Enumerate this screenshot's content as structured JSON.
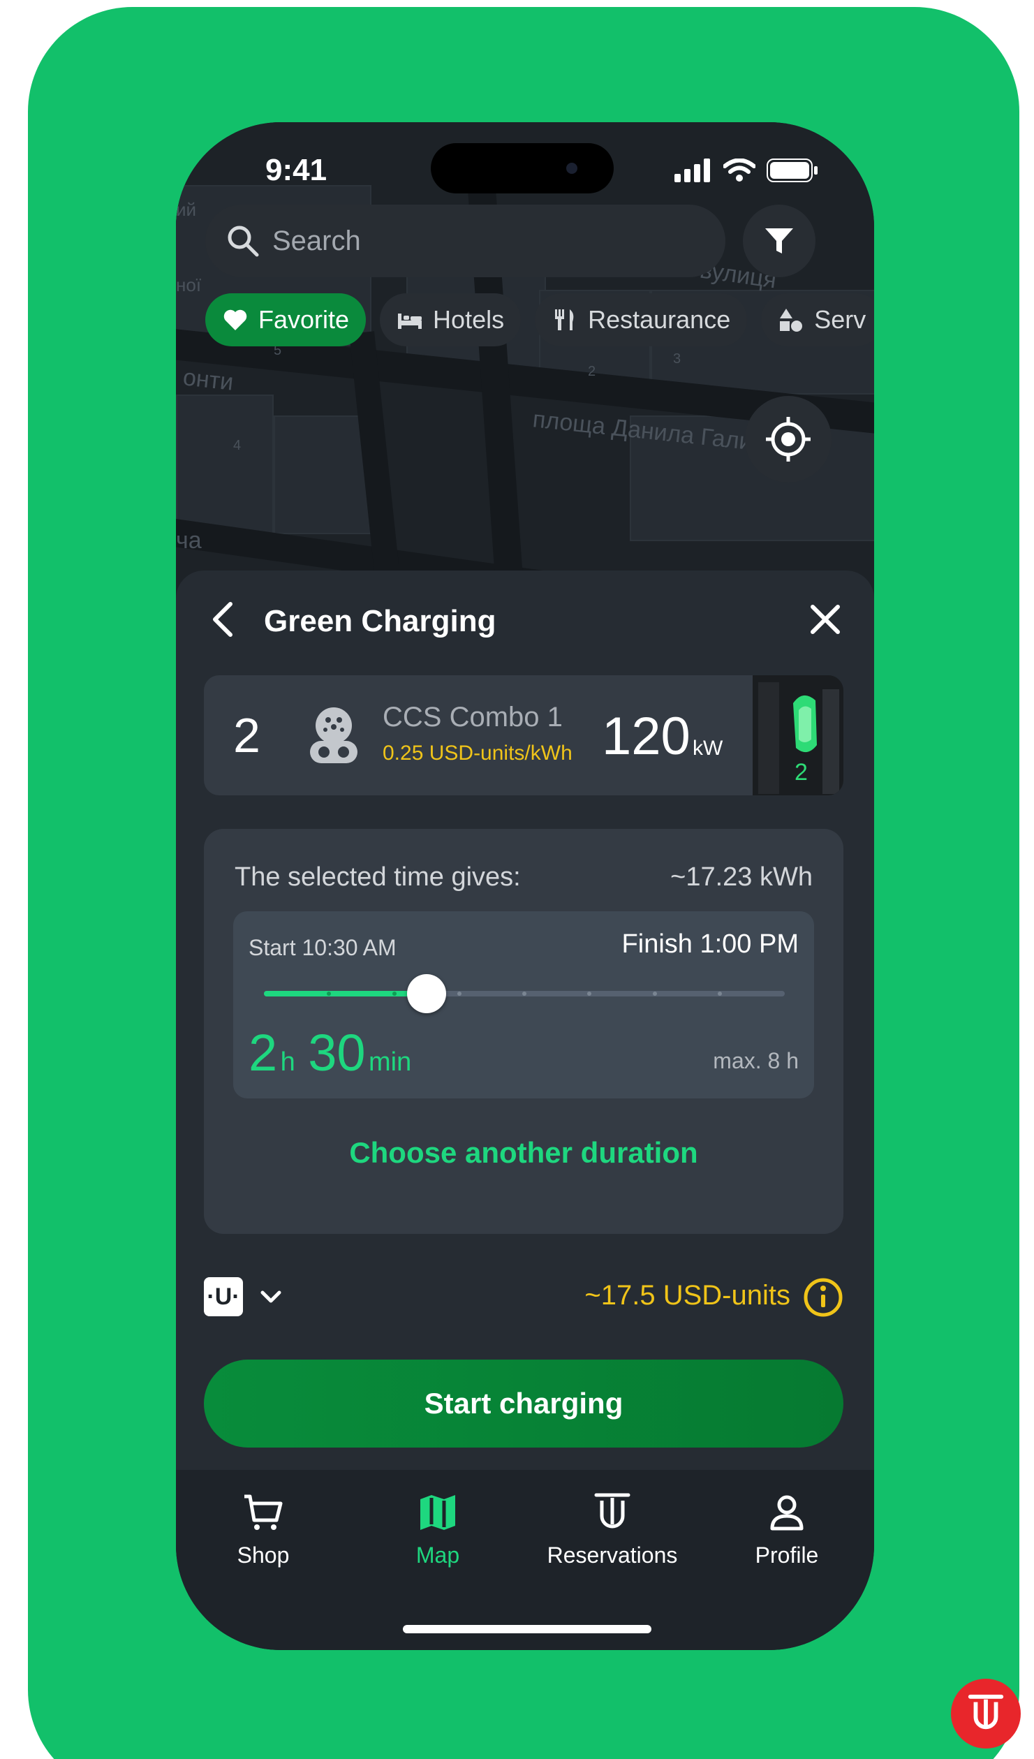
{
  "status_bar": {
    "time": "9:41"
  },
  "search": {
    "placeholder": "Search"
  },
  "chips": [
    {
      "label": "Favorite",
      "icon": "heart-icon"
    },
    {
      "label": "Hotels",
      "icon": "bed-icon"
    },
    {
      "label": "Restaurance",
      "icon": "fork-knife-icon"
    },
    {
      "label": "Serv",
      "icon": "shapes-icon"
    }
  ],
  "map": {
    "street_labels": [
      "вулиця",
      "площа Данила Галицького",
      "онти",
      "нoї",
      "ча",
      "ий"
    ],
    "house_numbers": [
      "5",
      "2",
      "3",
      "4"
    ]
  },
  "station": {
    "title": "Green Charging"
  },
  "connector": {
    "number": "2",
    "type": "CCS Combo 1",
    "price": "0.25 USD-units/kWh",
    "power": "120",
    "power_unit": "kW",
    "photo_badge": "2"
  },
  "time_selection": {
    "label": "The selected time gives:",
    "energy": "~17.23 kWh",
    "start": "Start 10:30 AM",
    "finish": "Finish 1:00 PM",
    "hours": "2",
    "hours_unit": "h",
    "minutes": "30",
    "minutes_unit": "min",
    "max": "max. 8 h",
    "slider_value_hours": 2.5,
    "slider_max_hours": 8,
    "another_duration": "Choose another duration"
  },
  "payment": {
    "currency_symbol": "·U·",
    "total": "~17.5 USD-units"
  },
  "start_button": "Start charging",
  "tabs": [
    {
      "label": "Shop",
      "icon": "cart-icon",
      "active": false
    },
    {
      "label": "Map",
      "icon": "map-icon",
      "active": true
    },
    {
      "label": "Reservations",
      "icon": "reservations-icon",
      "active": false
    },
    {
      "label": "Profile",
      "icon": "person-icon",
      "active": false
    }
  ],
  "colors": {
    "brand_green": "#12c06a",
    "accent_green": "#1ed77f",
    "button_green": "#088c3b",
    "price_yellow": "#f0c419",
    "badge_red": "#e8262b"
  }
}
